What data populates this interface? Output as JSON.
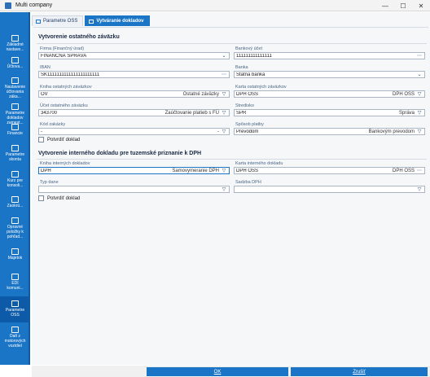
{
  "window": {
    "title": "Multi company",
    "minimize_icon": "minimize-icon",
    "maximize_icon": "maximize-icon",
    "close_icon": "close-icon"
  },
  "sidebar": {
    "items": [
      {
        "label": "Základné\nnastave...",
        "icon": "settings-icon"
      },
      {
        "label": "Účtova...",
        "icon": "ledger-icon"
      },
      {
        "label": "Nastavenie\núčtovania\nzáka...",
        "icon": "settings-icon"
      },
      {
        "label": "Parametre\ndokladov\nzamest...",
        "icon": "document-icon"
      },
      {
        "label": "Financie",
        "icon": "bank-icon"
      },
      {
        "label": "Parametre\nskonta",
        "icon": "percent-icon"
      },
      {
        "label": "Kurz pre\nkonsoli...",
        "icon": "exchange-icon"
      },
      {
        "label": "Zaokrú...",
        "icon": "rounding-icon"
      },
      {
        "label": "Opravné\npoložky k\npohľad...",
        "icon": "list-icon"
      },
      {
        "label": "Majetok",
        "icon": "asset-icon"
      },
      {
        "label": "EDI\nkomuni...",
        "icon": "mail-icon"
      },
      {
        "label": "Parametre\nOSS",
        "icon": "cart-icon"
      },
      {
        "label": "Daň z\nmotorových\nvozidiel",
        "icon": "car-icon"
      }
    ]
  },
  "tabs": [
    {
      "label": "Parametre OSS",
      "icon": "settings-icon"
    },
    {
      "label": "Vytváranie dokladov",
      "icon": "document-icon"
    }
  ],
  "section1": {
    "title": "Vytvorenie ostatného záväzku",
    "firma_label": "Firma (Finančný úrad)",
    "firma_value": "FINANČNÁ SPRÁVA",
    "bank_account_label": "Bankový účet",
    "bank_account_value": "111111111111111",
    "iban_label": "IBAN",
    "iban_value": "SK1111111111111111111111",
    "bank_label": "Banka",
    "bank_value": "Štátna banka",
    "book_label": "Kniha ostatných záväzkov",
    "book_value": "OV",
    "book_secondary": "Ostatné záväzky",
    "card_label": "Karta ostatných záväzkov",
    "card_value": "DPH OSS",
    "card_secondary": "DPH OSS",
    "account_label": "Účet ostatného záväzku",
    "account_value": "343700",
    "account_secondary": "Zaúčtovanie platieb s FÚ",
    "center_label": "Stredisko",
    "center_value": "SPR",
    "center_secondary": "Správa",
    "order_label": "Kód zakázky",
    "order_value": "-",
    "payment_label": "Spôsob platby",
    "payment_value": "Prevodom",
    "payment_secondary": "Bankovým prevodom",
    "confirm_label": "Potvrdiť doklad"
  },
  "section2": {
    "title": "Vytvorenie interného dokladu pre tuzemské priznanie k DPH",
    "internal_book_label": "Kniha interných dokladov",
    "internal_book_value": "DPH",
    "internal_book_secondary": "Samovymeranie DPH",
    "internal_card_label": "Karta interného dokladu",
    "internal_card_value": "DPH OSS",
    "internal_card_secondary": "DPH OSS",
    "tax_type_label": "Typ dane",
    "tax_type_value": "",
    "vat_rate_label": "Sadzba DPH",
    "vat_rate_value": "",
    "confirm_label": "Potvrdiť doklad"
  },
  "footer": {
    "ok_label": "OK",
    "cancel_label": "Zrušiť"
  }
}
